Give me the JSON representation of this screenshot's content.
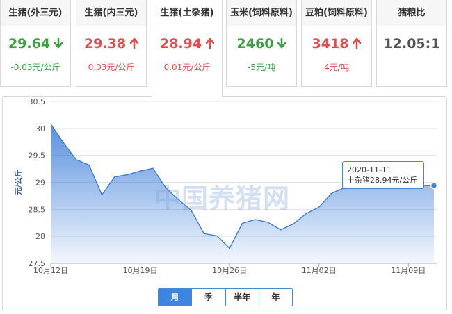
{
  "colors": {
    "up": "#e64c4c",
    "down": "#3ca043",
    "accent": "#3d85e0",
    "line": "#3b7dd8"
  },
  "cards": [
    {
      "title": "生猪(外三元)",
      "value": "29.64",
      "direction": "down",
      "change": "-0.03元/公斤"
    },
    {
      "title": "生猪(内三元)",
      "value": "29.38",
      "direction": "up",
      "change": "0.03元/公斤"
    },
    {
      "title": "生猪(土杂猪)",
      "value": "28.94",
      "direction": "up",
      "change": "0.01元/公斤",
      "active": true
    },
    {
      "title": "玉米(饲料原料)",
      "value": "2460",
      "direction": "down",
      "change": "-5元/吨"
    },
    {
      "title": "豆粕(饲料原料)",
      "value": "3418",
      "direction": "up",
      "change": "4元/吨"
    },
    {
      "title": "猪粮比",
      "value": "12.05:1",
      "direction": "none",
      "change": ""
    }
  ],
  "watermark": "中国养猪网",
  "tooltip": {
    "date": "2020-11-11",
    "text": "土杂猪28.94元/公斤"
  },
  "periods": [
    {
      "label": "月",
      "active": true
    },
    {
      "label": "季",
      "active": false
    },
    {
      "label": "半年",
      "active": false
    },
    {
      "label": "年",
      "active": false
    }
  ],
  "chart_data": {
    "type": "area",
    "ylabel": "元/公斤",
    "ylim": [
      27.5,
      30.5
    ],
    "yticks": [
      "30.5",
      "30",
      "29.5",
      "29",
      "28.5",
      "28",
      "27.5"
    ],
    "xlim": [
      0,
      30
    ],
    "xticks": [
      {
        "day": 0,
        "label": "10月12日"
      },
      {
        "day": 7,
        "label": "10月19日"
      },
      {
        "day": 14,
        "label": "10月26日"
      },
      {
        "day": 21,
        "label": "11月02日"
      },
      {
        "day": 28,
        "label": "11月09日"
      }
    ],
    "series": [
      {
        "x": [
          0,
          1,
          2,
          3,
          4,
          5,
          6,
          7,
          8,
          9,
          10,
          11,
          12,
          13,
          14,
          15,
          16,
          17,
          18,
          19,
          20,
          21,
          22,
          23,
          24,
          25,
          26,
          27,
          28,
          29,
          30
        ],
        "values": [
          30.08,
          29.73,
          29.42,
          29.32,
          28.77,
          29.1,
          29.14,
          29.21,
          29.26,
          28.9,
          28.68,
          28.48,
          28.05,
          28.01,
          27.78,
          28.24,
          28.31,
          28.26,
          28.12,
          28.23,
          28.42,
          28.54,
          28.8,
          28.9,
          28.94,
          28.93,
          28.92,
          28.93,
          28.93,
          28.94,
          28.94
        ]
      }
    ]
  }
}
